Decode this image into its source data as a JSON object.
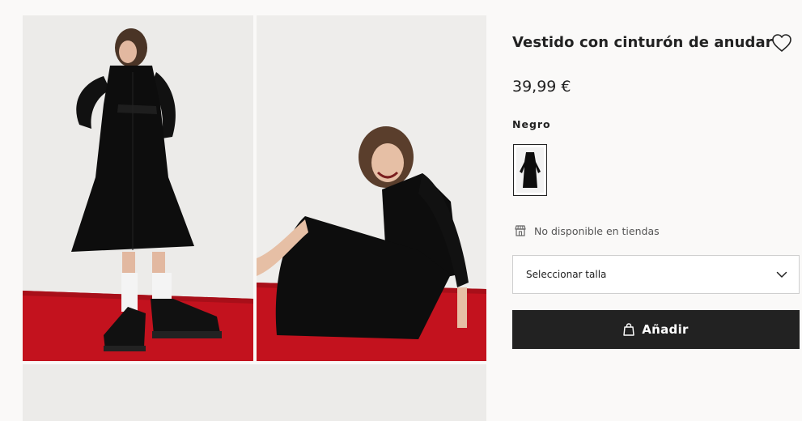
{
  "product": {
    "title": "Vestido con cinturón de anudar",
    "price": "39,99 €",
    "color_name": "Negro",
    "availability": "No disponible en tiendas"
  },
  "size_selector": {
    "label": "Seleccionar talla"
  },
  "add_button": {
    "label": "Añadir"
  },
  "icons": {
    "favorite": "heart-icon",
    "store": "store-icon",
    "chevron": "chevron-down-icon",
    "bag": "shopping-bag-icon"
  },
  "colors": {
    "background": "#faf9f8",
    "primary_button": "#222222",
    "text": "#222222",
    "floor_red": "#c3121e"
  }
}
